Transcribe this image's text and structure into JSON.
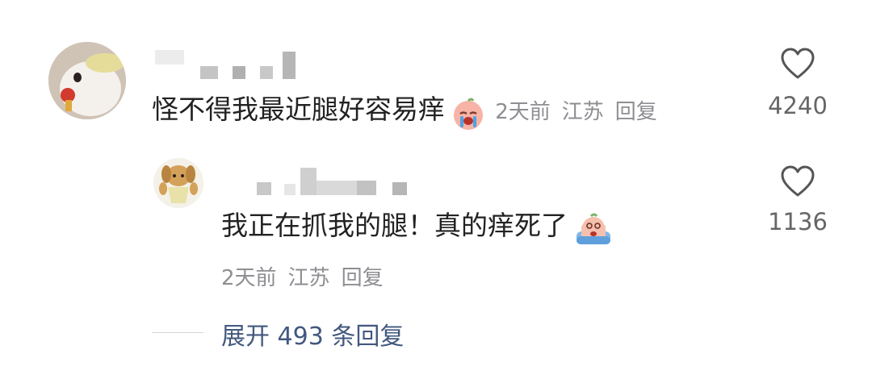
{
  "comment": {
    "text": "怪不得我最近腿好容易痒",
    "emoji_icon": "crying-face-emoji-icon",
    "time": "2天前",
    "location": "江苏",
    "reply_label": "回复",
    "like_count": "4240"
  },
  "reply": {
    "text": "我正在抓我的腿！真的痒死了",
    "emoji_icon": "screaming-face-emoji-icon",
    "time": "2天前",
    "location": "江苏",
    "reply_label": "回复",
    "like_count": "1136"
  },
  "expand": {
    "label": "展开 493 条回复"
  },
  "colors": {
    "text": "#222222",
    "meta": "#8e8e93",
    "link": "#42587e"
  }
}
